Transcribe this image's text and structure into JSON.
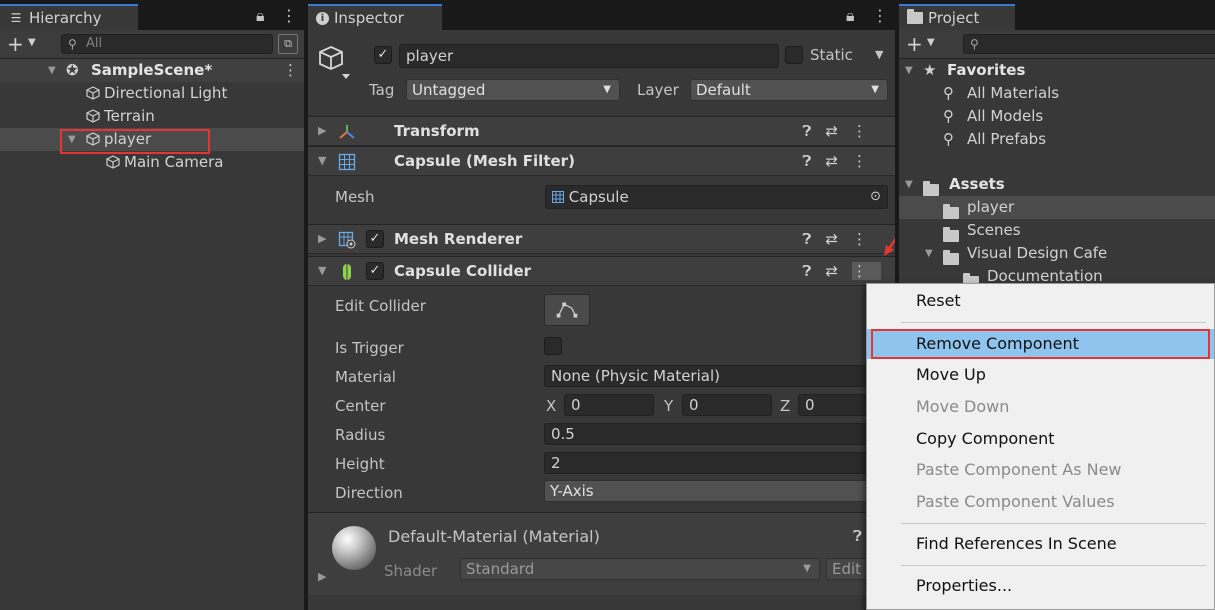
{
  "colors": {
    "accent": "#3a7ad5",
    "highlight_box": "#e63434",
    "menu_highlight": "#8fc4ef"
  },
  "hierarchy": {
    "tab_label": "Hierarchy",
    "search_placeholder": "All",
    "scene_name": "SampleScene*",
    "items": [
      {
        "label": "Directional Light"
      },
      {
        "label": "Terrain"
      },
      {
        "label": "player"
      },
      {
        "label": "Main Camera"
      }
    ]
  },
  "inspector": {
    "tab_label": "Inspector",
    "object_name": "player",
    "static_label": "Static",
    "tag_label": "Tag",
    "tag_value": "Untagged",
    "layer_label": "Layer",
    "layer_value": "Default",
    "components": {
      "transform": "Transform",
      "mesh_filter": "Capsule (Mesh Filter)",
      "mesh_renderer": "Mesh Renderer",
      "capsule_collider": "Capsule Collider"
    },
    "mesh_label": "Mesh",
    "mesh_value": "Capsule",
    "collider": {
      "edit_collider": "Edit Collider",
      "is_trigger": "Is Trigger",
      "material_label": "Material",
      "material_value": "None (Physic Material)",
      "center_label": "Center",
      "center_x": "0",
      "center_y": "0",
      "center_z": "0",
      "x_label": "X",
      "y_label": "Y",
      "z_label": "Z",
      "radius_label": "Radius",
      "radius_value": "0.5",
      "height_label": "Height",
      "height_value": "2",
      "direction_label": "Direction",
      "direction_value": "Y-Axis"
    },
    "material_asset": "Default-Material (Material)",
    "shader_label": "Shader",
    "shader_value": "Standard",
    "edit_button": "Edit"
  },
  "project": {
    "tab_label": "Project",
    "favorites": "Favorites",
    "favorite_items": [
      {
        "label": "All Materials"
      },
      {
        "label": "All Models"
      },
      {
        "label": "All Prefabs"
      }
    ],
    "assets": "Assets",
    "asset_items": [
      {
        "label": "player"
      },
      {
        "label": "Scenes"
      },
      {
        "label": "Visual Design Cafe"
      },
      {
        "label": "Documentation"
      }
    ]
  },
  "context_menu": {
    "items": [
      {
        "label": "Reset"
      },
      {
        "label": "Remove Component"
      },
      {
        "label": "Move Up"
      },
      {
        "label": "Move Down"
      },
      {
        "label": "Copy Component"
      },
      {
        "label": "Paste Component As New"
      },
      {
        "label": "Paste Component Values"
      },
      {
        "label": "Find References In Scene"
      },
      {
        "label": "Properties..."
      }
    ]
  }
}
